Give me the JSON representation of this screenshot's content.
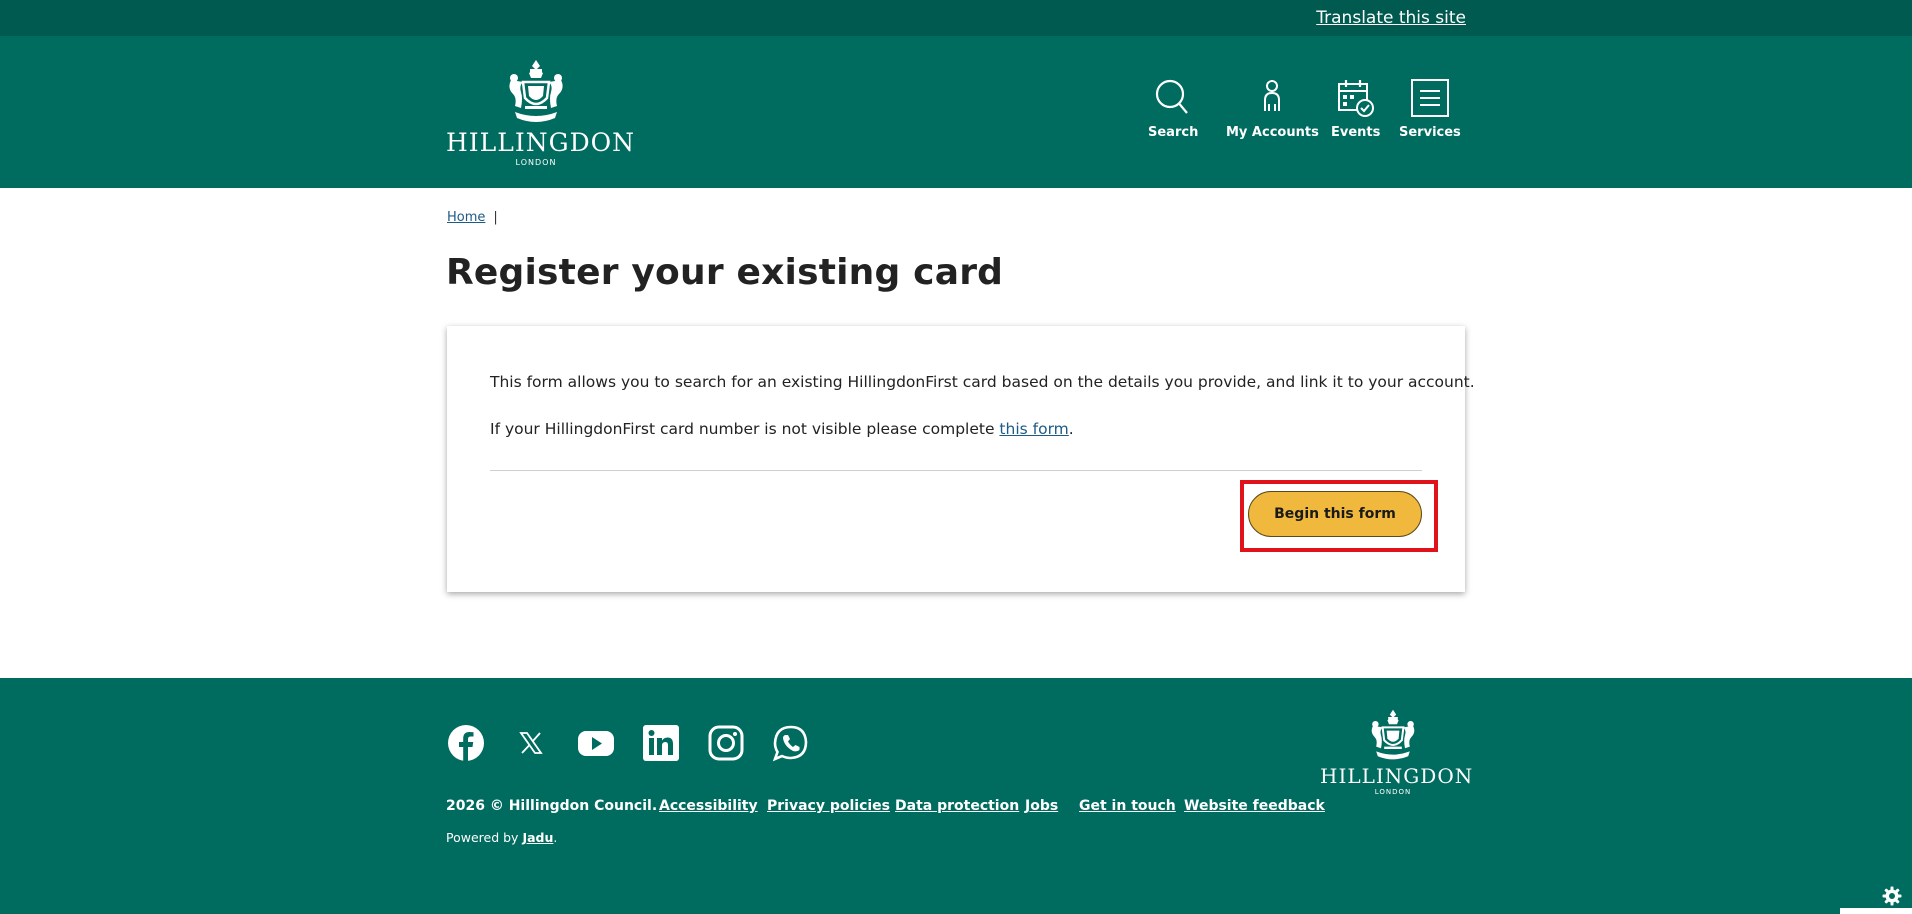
{
  "topbar": {
    "translate_label": "Translate this site"
  },
  "header": {
    "logo": {
      "brand": "HILLINGDON",
      "sub": "LONDON",
      "icon": "coat-of-arms"
    },
    "nav": [
      {
        "label": "Search",
        "icon": "search-icon"
      },
      {
        "label": "My Accounts",
        "icon": "person-icon"
      },
      {
        "label": "Events",
        "icon": "calendar-check-icon"
      },
      {
        "label": "Services",
        "icon": "menu-icon"
      }
    ]
  },
  "breadcrumb": {
    "home": "Home",
    "separator": "|"
  },
  "page": {
    "title": "Register your existing card"
  },
  "card": {
    "intro": "This form allows you to search for an existing HillingdonFirst card based on the details you provide, and link it to your account.",
    "note_prefix": "If your HillingdonFirst card number is not visible please complete ",
    "note_link": "this form",
    "note_suffix": ".",
    "begin_button": "Begin this form"
  },
  "footer": {
    "social": [
      "facebook-icon",
      "x-icon",
      "youtube-icon",
      "linkedin-icon",
      "instagram-icon",
      "whatsapp-icon"
    ],
    "copyright": "2026 © Hillingdon Council.",
    "links": [
      "Accessibility",
      "Privacy policies",
      "Data protection",
      "Jobs",
      "Get in touch",
      "Website feedback"
    ],
    "powered_prefix": "Powered by ",
    "powered_link": "Jadu",
    "powered_suffix": ".",
    "logo": {
      "brand": "HILLINGDON",
      "sub": "LONDON"
    }
  },
  "colors": {
    "header_bg": "#006b5f",
    "topbar_bg": "#005a4f",
    "button_bg": "#f0b93e",
    "highlight": "#e0131b",
    "link": "#1d5b87"
  }
}
